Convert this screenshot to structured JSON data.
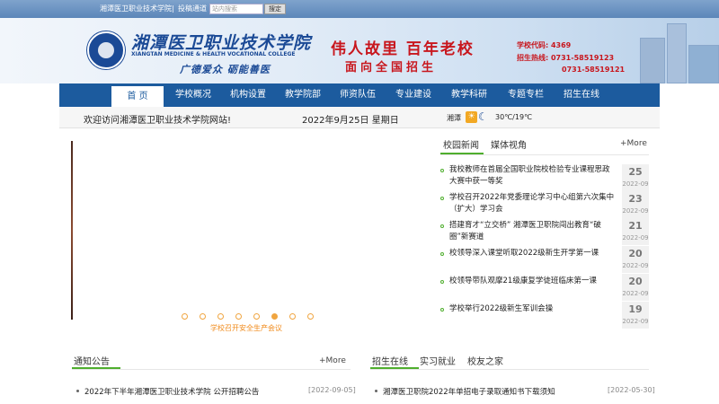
{
  "topbar": {
    "school_link": "湘潭医卫职业技术学院",
    "divider": "|",
    "submit_link": "投稿通道",
    "search_placeholder": "站内搜索",
    "search_button": "搜定"
  },
  "banner": {
    "school_name_cn": "湘潭医卫职业技术学院",
    "school_name_en": "XIANGTAN MEDICINE & HEALTH VOCATIONAL COLLEGE",
    "motto": "广德爱众 砺能善医",
    "slogan_line1": "伟人故里 百年老校",
    "slogan_line2": "面向全国招生",
    "school_code": "学校代码: 4369",
    "hotline": "招生热线: 0731-58519123",
    "hotline2": "0731-58519121"
  },
  "nav": {
    "items": [
      {
        "label": "首 页"
      },
      {
        "label": "学校概况"
      },
      {
        "label": "机构设置"
      },
      {
        "label": "教学院部"
      },
      {
        "label": "师资队伍"
      },
      {
        "label": "专业建设"
      },
      {
        "label": "教学科研"
      },
      {
        "label": "专题专栏"
      },
      {
        "label": "招生在线"
      }
    ]
  },
  "info": {
    "welcome": "欢迎访问湘潭医卫职业技术学院网站!",
    "date": "2022年9月25日 星期日",
    "city": "湘潭",
    "weather_day_icon": "sun-icon",
    "weather_night_icon": "moon-icon",
    "temperature": "30℃/19℃"
  },
  "slider": {
    "caption": "学校召开安全生产会议",
    "dot_count": 8,
    "active_dot": 6
  },
  "news": {
    "tab_campus": "校园新闻",
    "tab_media": "媒体视角",
    "more": "+More",
    "items": [
      {
        "title": "我校教师在首届全国职业院校检验专业课程思政大赛中获一等奖",
        "day": "25",
        "ym": "2022-09"
      },
      {
        "title": "学校召开2022年党委理论学习中心组第六次集中（扩大）学习会",
        "day": "23",
        "ym": "2022-09"
      },
      {
        "title": "搭建育才“立交桥” 湘潭医卫职院闯出教育“破圈”新赛道",
        "day": "21",
        "ym": "2022-09"
      },
      {
        "title": "校领导深入课堂听取2022级新生开学第一课",
        "day": "20",
        "ym": "2022-09"
      },
      {
        "title": "校领导带队观摩21级康复学徒班临床第一课",
        "day": "20",
        "ym": "2022-09"
      },
      {
        "title": "学校举行2022级新生军训会操",
        "day": "19",
        "ym": "2022-09"
      }
    ]
  },
  "notice": {
    "title": "通知公告",
    "more": "+More",
    "items": [
      {
        "title": "2022年下半年湘潭医卫职业技术学院 公开招聘公告",
        "date": "[2022-09-05]"
      }
    ]
  },
  "admission": {
    "tab1": "招生在线",
    "tab2": "实习就业",
    "tab3": "校友之家",
    "items": [
      {
        "title": "湘潭医卫职院2022年单招电子录取通知书下载须知",
        "date": "[2022-05-30]"
      }
    ]
  },
  "colors": {
    "nav_blue": "#1c5b9e",
    "accent_green": "#4fae2e",
    "slogan_red": "#c8161d",
    "caption_orange": "#f08a1a"
  }
}
